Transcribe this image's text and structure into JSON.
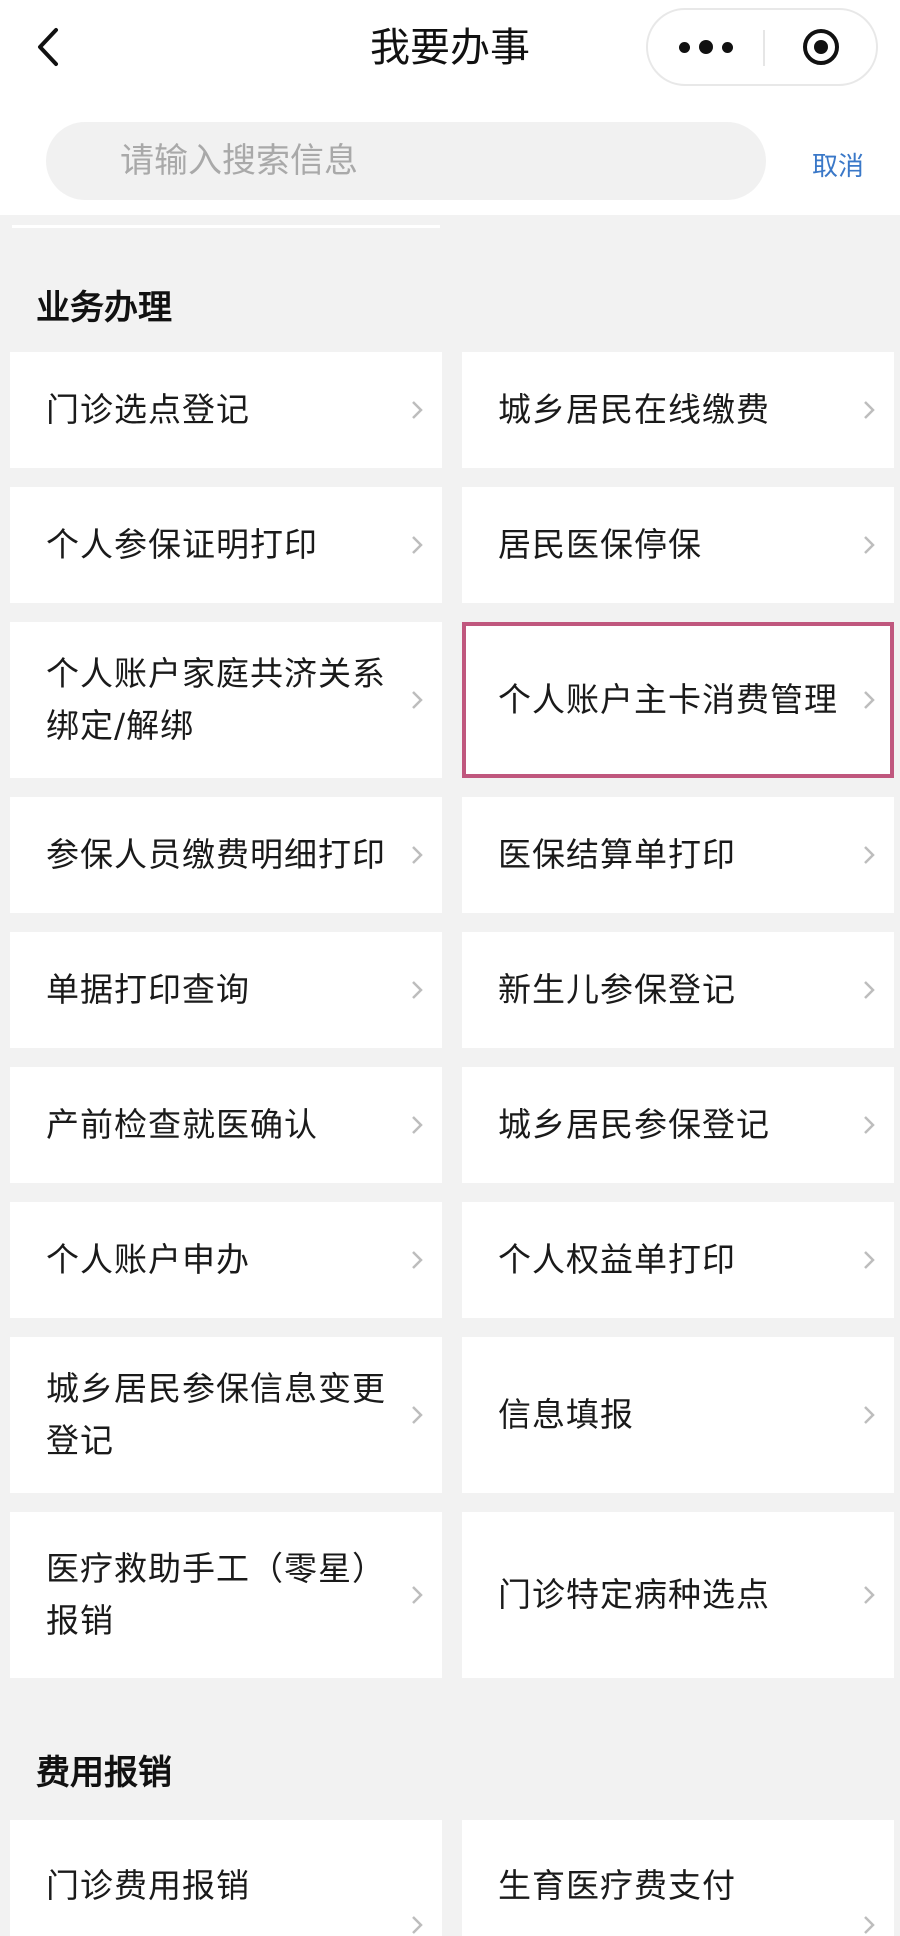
{
  "header": {
    "title": "我要办事"
  },
  "search": {
    "placeholder": "请输入搜索信息",
    "cancel_label": "取消"
  },
  "sections": [
    {
      "title": "业务办理",
      "items": [
        {
          "label": "门诊选点登记"
        },
        {
          "label": "城乡居民在线缴费"
        },
        {
          "label": "个人参保证明打印"
        },
        {
          "label": "居民医保停保"
        },
        {
          "label": "个人账户家庭共济关系绑定/解绑"
        },
        {
          "label": "个人账户主卡消费管理",
          "highlighted": true
        },
        {
          "label": "参保人员缴费明细打印"
        },
        {
          "label": "医保结算单打印"
        },
        {
          "label": "单据打印查询"
        },
        {
          "label": "新生儿参保登记"
        },
        {
          "label": "产前检查就医确认"
        },
        {
          "label": "城乡居民参保登记"
        },
        {
          "label": "个人账户申办"
        },
        {
          "label": "个人权益单打印"
        },
        {
          "label": "城乡居民参保信息变更登记"
        },
        {
          "label": "信息填报"
        },
        {
          "label": "医疗救助手工（零星）报销"
        },
        {
          "label": "门诊特定病种选点"
        }
      ]
    },
    {
      "title": "费用报销",
      "items": [
        {
          "label": "门诊费用报销"
        },
        {
          "label": "生育医疗费支付"
        }
      ]
    }
  ],
  "colors": {
    "background": "#f2f2f2",
    "card": "#ffffff",
    "accent_link": "#3a78c8",
    "highlight_border": "#c0577e"
  }
}
